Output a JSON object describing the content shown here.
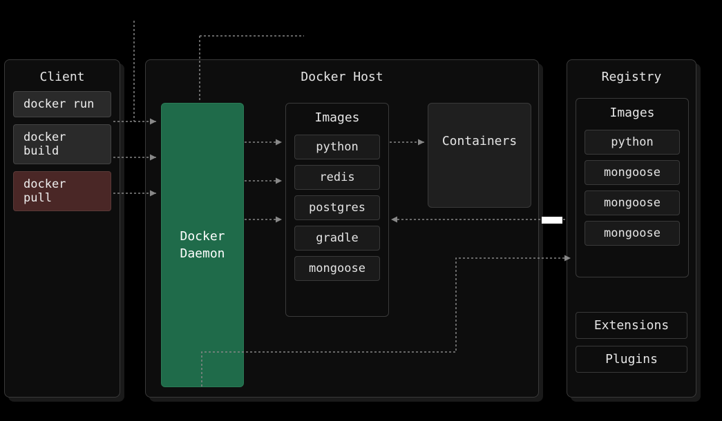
{
  "client": {
    "title": "Client",
    "commands": [
      "docker run",
      "docker build",
      "docker pull"
    ]
  },
  "host": {
    "title": "Docker Host",
    "daemon": "Docker\nDaemon",
    "images_title": "Images",
    "images": [
      "python",
      "redis",
      "postgres",
      "gradle",
      "mongoose"
    ],
    "containers": "Containers"
  },
  "registry": {
    "title": "Registry",
    "images_title": "Images",
    "images": [
      "python",
      "mongoose",
      "mongoose",
      "mongoose"
    ],
    "extensions": "Extensions",
    "plugins": "Plugins"
  }
}
